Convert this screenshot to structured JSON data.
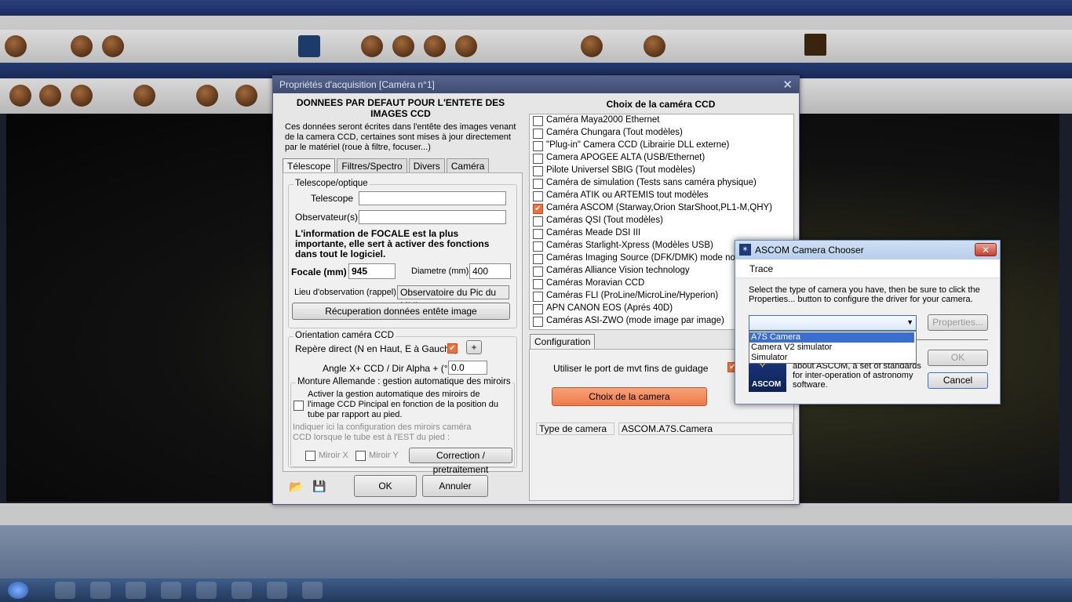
{
  "main_dialog": {
    "title": "Propriétés d'acquisition [Caméra n°1]",
    "close_glyph": "✕",
    "left": {
      "header": "DONNEES PAR DEFAUT POUR L'ENTETE DES IMAGES CCD",
      "description": "Ces données seront écrites dans l'entête des images  venant de la camera CCD, certaines sont mises à jour directement par le matériel (roue à filtre, focuser...)",
      "tabs": [
        "Télescope",
        "Filtres/Spectro",
        "Divers",
        "Caméra"
      ],
      "telescope_group": {
        "legend": "Telescope/optique",
        "telescope_label": "Telescope",
        "telescope_value": "",
        "observer_label": "Observateur(s)",
        "observer_value": "",
        "focal_note": "L'information de FOCALE est la plus importante, elle sert à activer des fonctions dans tout le logiciel.",
        "focal_label": "Focale (mm)",
        "focal_value": "945",
        "diameter_label": "Diametre (mm)",
        "diameter_value": "400",
        "location_label": "Lieu d'observation (rappel)",
        "location_value": "Observatoire du Pic du Midi",
        "recover_button": "Récuperation données entête image"
      },
      "orientation_group": {
        "legend": "Orientation caméra CCD",
        "direct_label": "Repère direct (N en Haut, E à Gauche)",
        "direct_checked": true,
        "plus_button": "+",
        "angle_label": "Angle X+ CCD / Dir Alpha + (°) :",
        "angle_value": "0.0"
      },
      "mount_group": {
        "legend": "Monture Allemande : gestion automatique des miroirs",
        "auto_label": "Activer la gestion automatique des miroirs de l'image CCD Pincipal en fonction de la position du tube par rapport au pied.",
        "config_note": "Indiquer ici la configuration des miroirs caméra CCD lorsque le tube est à l'EST du pied :",
        "mirror_x": "Miroir X",
        "mirror_y": "Miroir Y",
        "correction_button": "Correction / pretraitement"
      },
      "ok_button": "OK",
      "cancel_button": "Annuler"
    },
    "right": {
      "header": "Choix de la caméra CCD",
      "cameras": [
        {
          "label": "Caméra Maya2000 Ethernet",
          "checked": false
        },
        {
          "label": "Caméra Chungara (Tout modèles)",
          "checked": false
        },
        {
          "label": "\"Plug-in\" Camera CCD (Librairie DLL externe)",
          "checked": false
        },
        {
          "label": "Camera APOGEE ALTA (USB/Ethernet)",
          "checked": false
        },
        {
          "label": "Pilote Universel SBIG (Tout modèles)",
          "checked": false
        },
        {
          "label": "Caméra de simulation (Tests sans caméra physique)",
          "checked": false
        },
        {
          "label": "Caméra ATIK ou ARTEMIS tout modèles",
          "checked": false
        },
        {
          "label": "Caméra ASCOM (Starway,Orion StarShoot,PL1-M,QHY)",
          "checked": true
        },
        {
          "label": "Caméras QSI (Tout modèles)",
          "checked": false
        },
        {
          "label": "Caméras Meade DSI III",
          "checked": false
        },
        {
          "label": "Caméras Starlight-Xpress (Modèles USB)",
          "checked": false
        },
        {
          "label": "Caméras Imaging Source (DFK/DMK) mode non vid",
          "checked": false
        },
        {
          "label": "Caméras Alliance Vision technology",
          "checked": false
        },
        {
          "label": "Caméras Moravian CCD",
          "checked": false
        },
        {
          "label": "Caméras FLI (ProLine/MicroLine/Hyperion)",
          "checked": false
        },
        {
          "label": "APN CANON EOS (Aprés 40D)",
          "checked": false
        },
        {
          "label": "Caméras ASI-ZWO (mode image par image)",
          "checked": false
        }
      ],
      "config_tab": "Configuration",
      "guiding_label": "Utiliser le port de mvt fins de guidage",
      "guiding_checked": true,
      "choose_button": "Choix de la camera",
      "type_label": "Type de camera",
      "type_value": "ASCOM.A7S.Camera"
    }
  },
  "ascom_dialog": {
    "title": "ASCOM Camera Chooser",
    "close_glyph": "✕",
    "menu": "Trace",
    "instructions": "Select the type of camera you have, then be sure to click the Properties... button to configure the driver for your camera.",
    "selected_value": "",
    "options": [
      "A7S Camera",
      "Camera V2 simulator",
      "Simulator"
    ],
    "highlighted_index": 0,
    "properties_button": "Properties...",
    "about_text": "about ASCOM, a set of standards for inter-operation of astronomy software.",
    "logo_text": "ASCOM",
    "ok_button": "OK",
    "cancel_button": "Cancel"
  }
}
